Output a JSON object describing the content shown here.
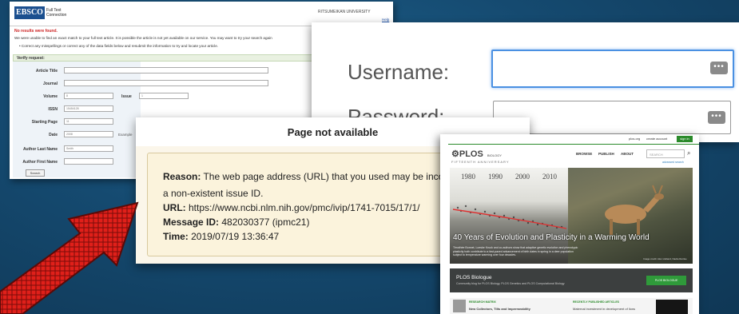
{
  "ebsco": {
    "logo": "EBSCO",
    "logo_sub": "Full Text Connection",
    "university": "RITSUMEIKAN UNIVERSITY",
    "help": "Help",
    "error": "No results were found.",
    "info1": "We were unable to find an exact match to your full text article. It is possible the article is not yet available on our service. You may want to try your search again",
    "info2": "• Correct any misspellings or correct any of the data fields below and resubmit the information to try and locate your article.",
    "verify": "Verify request:",
    "fields": {
      "article_title": {
        "label": "Article Title",
        "value": ""
      },
      "journal": {
        "label": "Journal",
        "value": ""
      },
      "volume": {
        "label": "Volume",
        "value": "8"
      },
      "issue": {
        "label": "Issue",
        "value": "1"
      },
      "issn": {
        "label": "ISSN",
        "value": "15454128"
      },
      "starting_page": {
        "label": "Starting Page",
        "value": "11"
      },
      "date": {
        "label": "Date",
        "value": "2008"
      },
      "date_hint": "Example",
      "author_last": {
        "label": "Author Last Name",
        "value": "Smith"
      },
      "author_first": {
        "label": "Author First Name",
        "value": ""
      }
    },
    "search_btn": "Search"
  },
  "login": {
    "username_label": "Username:",
    "password_label": "Password:",
    "key_icon_text": "•••"
  },
  "pna": {
    "title": "Page not available",
    "reason_label": "Reason:",
    "reason_text": " The web page address (URL) that you used may be incorrect",
    "reason_text2": "a non-existent issue ID.",
    "url_label": "URL:",
    "url": " https://www.ncbi.nlm.nih.gov/pmc/ivip/1741-7015/17/1/",
    "msg_label": "Message ID:",
    "msg": " 482030377 (ipmc21)",
    "time_label": "Time:",
    "time": " 2019/07/19 13:36:47"
  },
  "plos": {
    "top_links": [
      "plos.org",
      "create account"
    ],
    "login": "sign in",
    "brand": "PLOS",
    "brand_journal": "BIOLOGY",
    "brand_sub": "FIFTEENTH ANNIVERSARY",
    "nav": [
      "BROWSE",
      "PUBLISH",
      "ABOUT"
    ],
    "search_placeholder": "SEARCH",
    "advanced": "advanced search",
    "years": [
      "1980",
      "1990",
      "2000",
      "2010"
    ],
    "hero_title": "40 Years of Evolution and Plasticity in a Warming World",
    "hero_desc": "Timothée Bonnet, Loeske Kruuk and co-authors show that adaptive genetic evolution and phenotypic plasticity both contribute to a fast-paced advancement of birth dates in spring in a deer population subject to temperature warming over four decades.",
    "hero_credit": "Image credit: Alex Holland, Nadia Reinke",
    "blog_title": "PLOS Biologue",
    "blog_desc": "Community blog for PLOS Biology, PLOS Genetics and PLOS Computational Biology",
    "blog_btn": "PLOS BIOLOGUE",
    "strip_label1": "RESEARCH MATRIX",
    "strip_text1": "New Collectors, Tilts and Impermeability",
    "strip_label2": "RECENTLY PUBLISHED ARTICLES",
    "strip_text2": "Maternal investment in development of lions"
  }
}
